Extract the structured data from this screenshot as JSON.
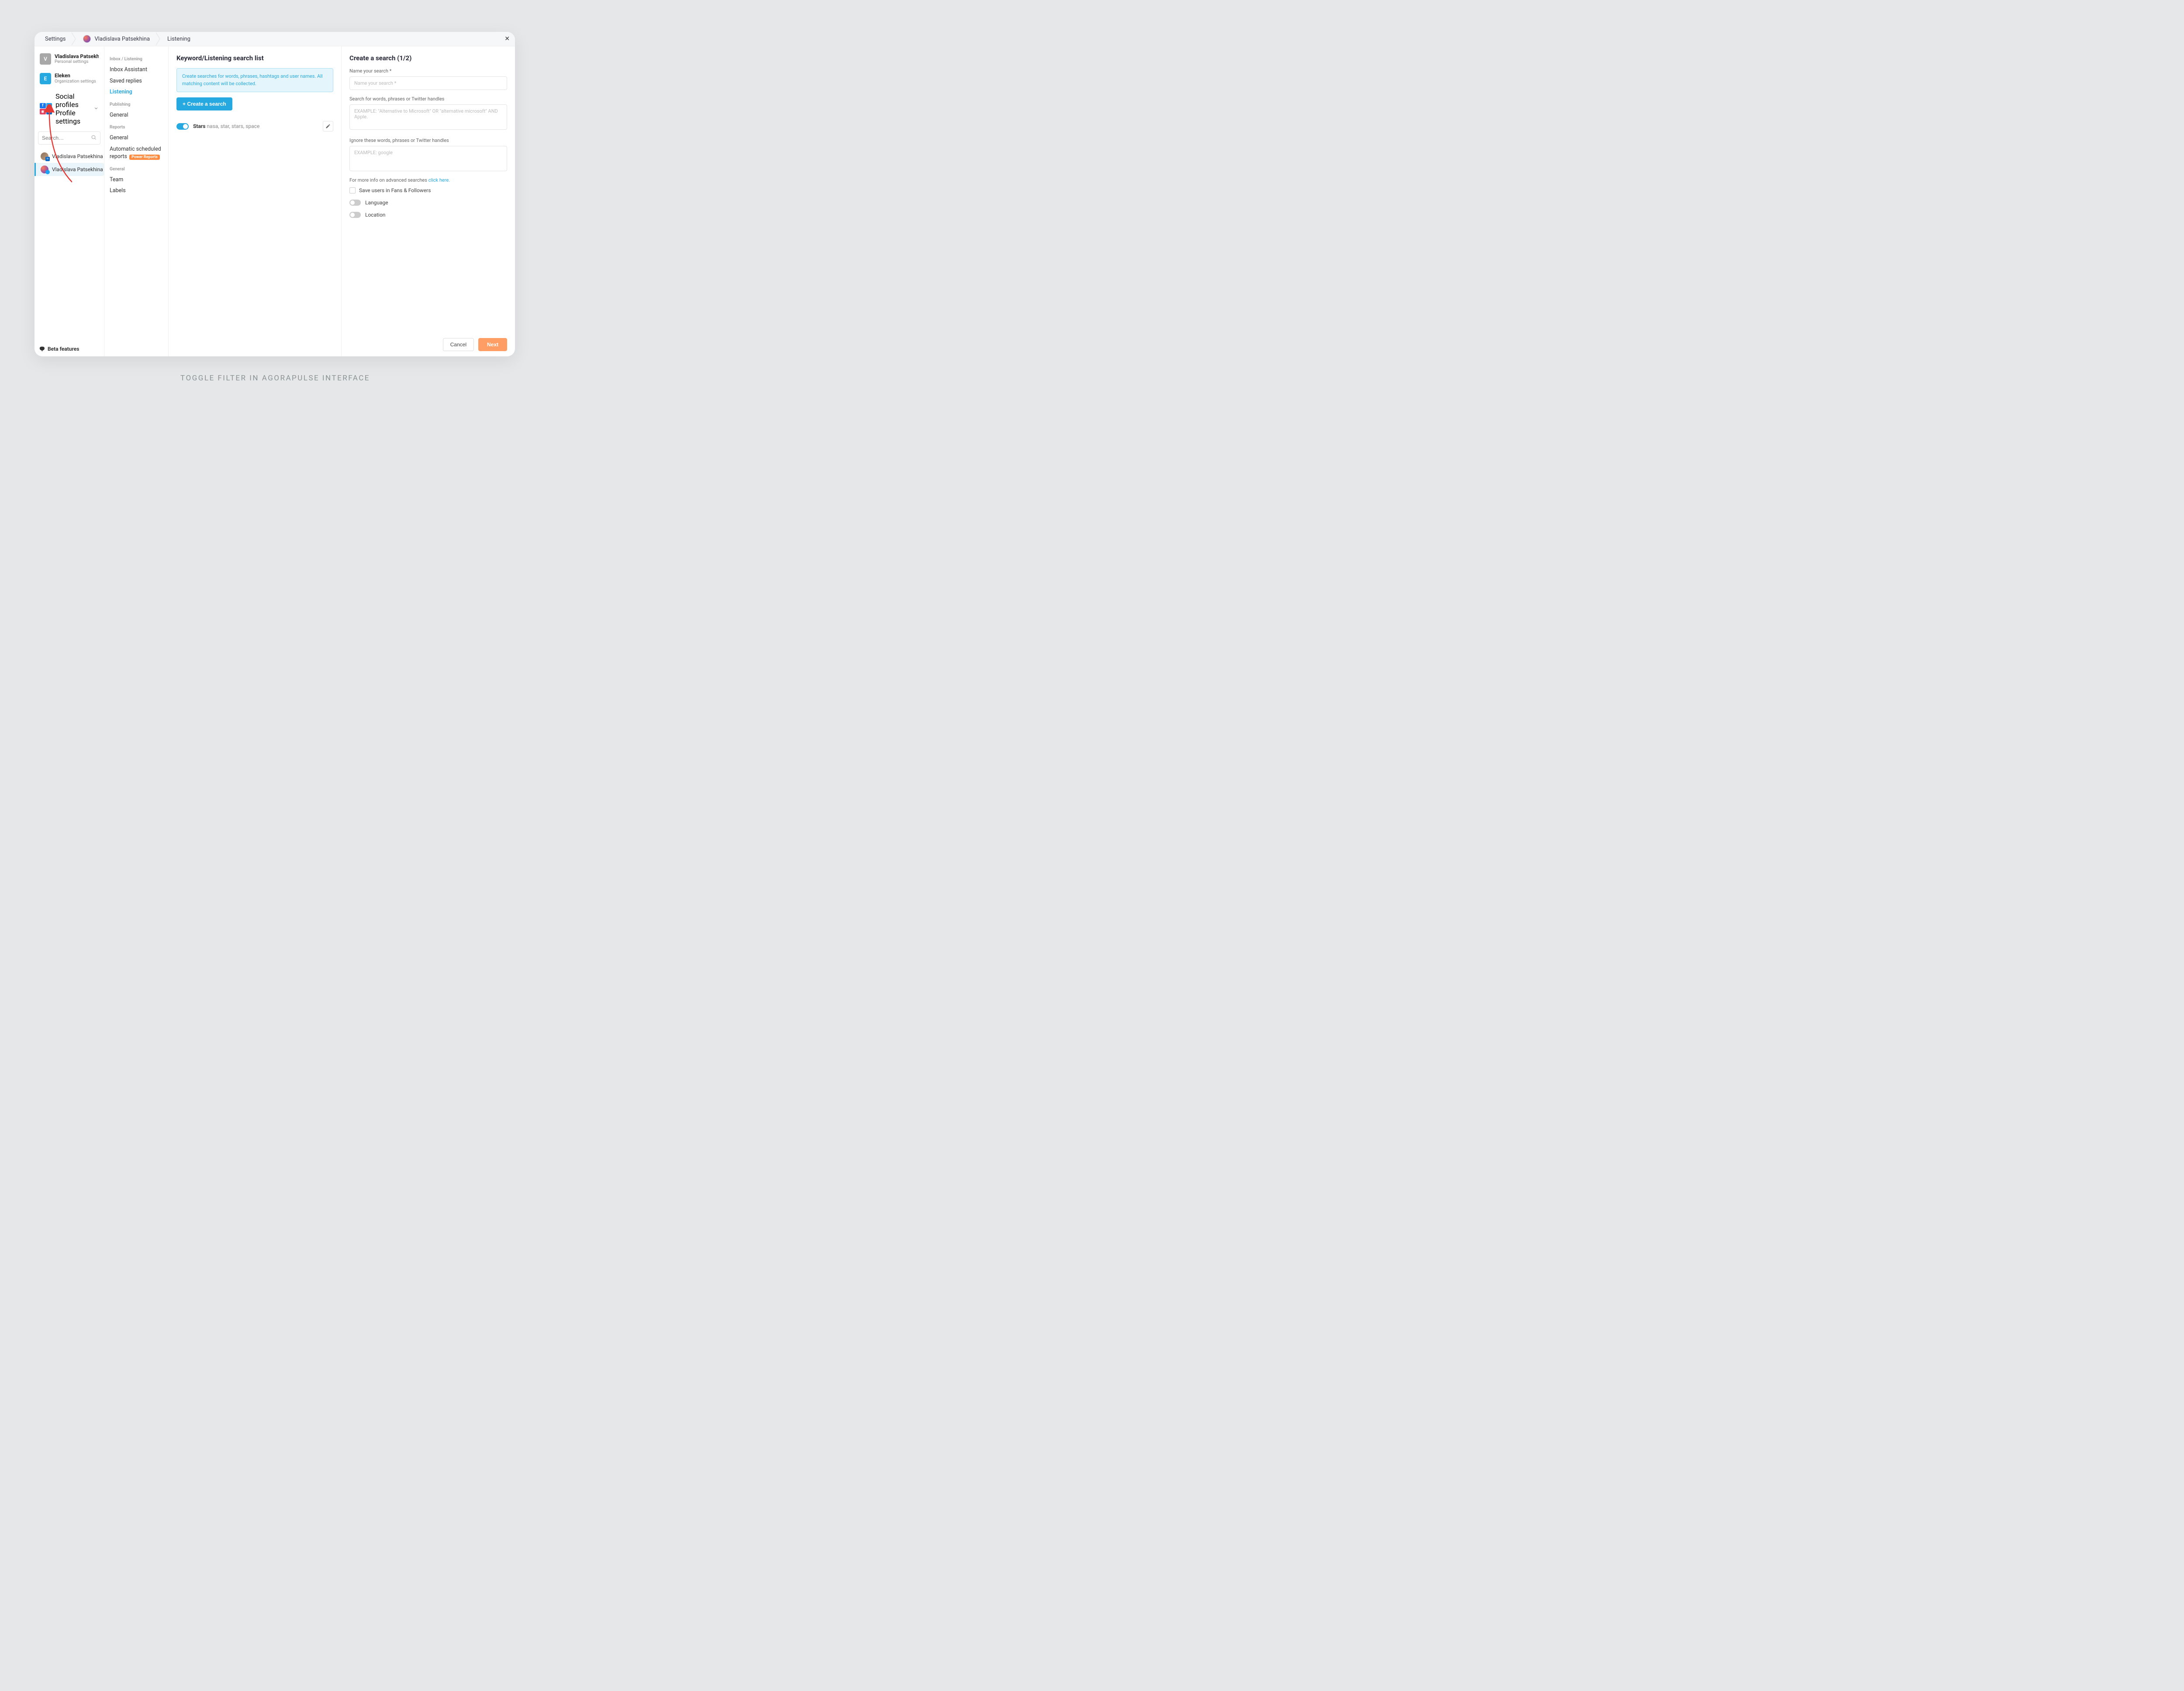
{
  "breadcrumb": {
    "root": "Settings",
    "user": "Vladislava Patsekhina",
    "page": "Listening"
  },
  "col1": {
    "accounts": [
      {
        "initial": "V",
        "name": "Vladislava Patsekhina",
        "sub": "Personal settings"
      },
      {
        "initial": "E",
        "name": "Eleken",
        "sub": "Organization settings"
      }
    ],
    "social": {
      "title": "Social profiles",
      "sub": "Profile settings"
    },
    "search_placeholder": "Search…",
    "profiles": [
      {
        "name": "Vladislava Patsekhina"
      },
      {
        "name": "Vladislava Patsekhina"
      }
    ],
    "beta": "Beta features"
  },
  "col2": {
    "g1": "Inbox / Listening",
    "g1_items": [
      "Inbox Assistant",
      "Saved replies",
      "Listening"
    ],
    "g2": "Publishing",
    "g2_items": [
      "General"
    ],
    "g3": "Reports",
    "g3_items": [
      "General",
      "Automatic scheduled reports"
    ],
    "badge": "Power Reports",
    "g4": "General",
    "g4_items": [
      "Team",
      "Labels"
    ]
  },
  "col3": {
    "title": "Keyword/Listening search list",
    "info": "Create searches for words, phrases, hashtags and user names. All matching content will be collected.",
    "create_btn": "+ Create a search",
    "item_name": "Stars",
    "item_keywords": "nasa, star, stars, space"
  },
  "col4": {
    "title": "Create a search (1/2)",
    "name_label": "Name your search *",
    "name_placeholder": "Name your search *",
    "words_label": "Search for words, phrases or Twitter handles",
    "words_placeholder": "EXAMPLE: \"Alternative to Microsoft\" OR \"alternative microsoft\" AND Apple.",
    "ignore_label": "Ignore these words, phrases or Twitter handles",
    "ignore_placeholder": "EXAMPLE: google",
    "help_text": "For more info on advanced searches ",
    "help_link": "click here.",
    "save_users": "Save users in Fans & Followers",
    "lang": "Language",
    "loc": "Location",
    "cancel": "Cancel",
    "next": "Next"
  },
  "caption": "TOGGLE FILTER IN AGORAPULSE INTERFACE"
}
